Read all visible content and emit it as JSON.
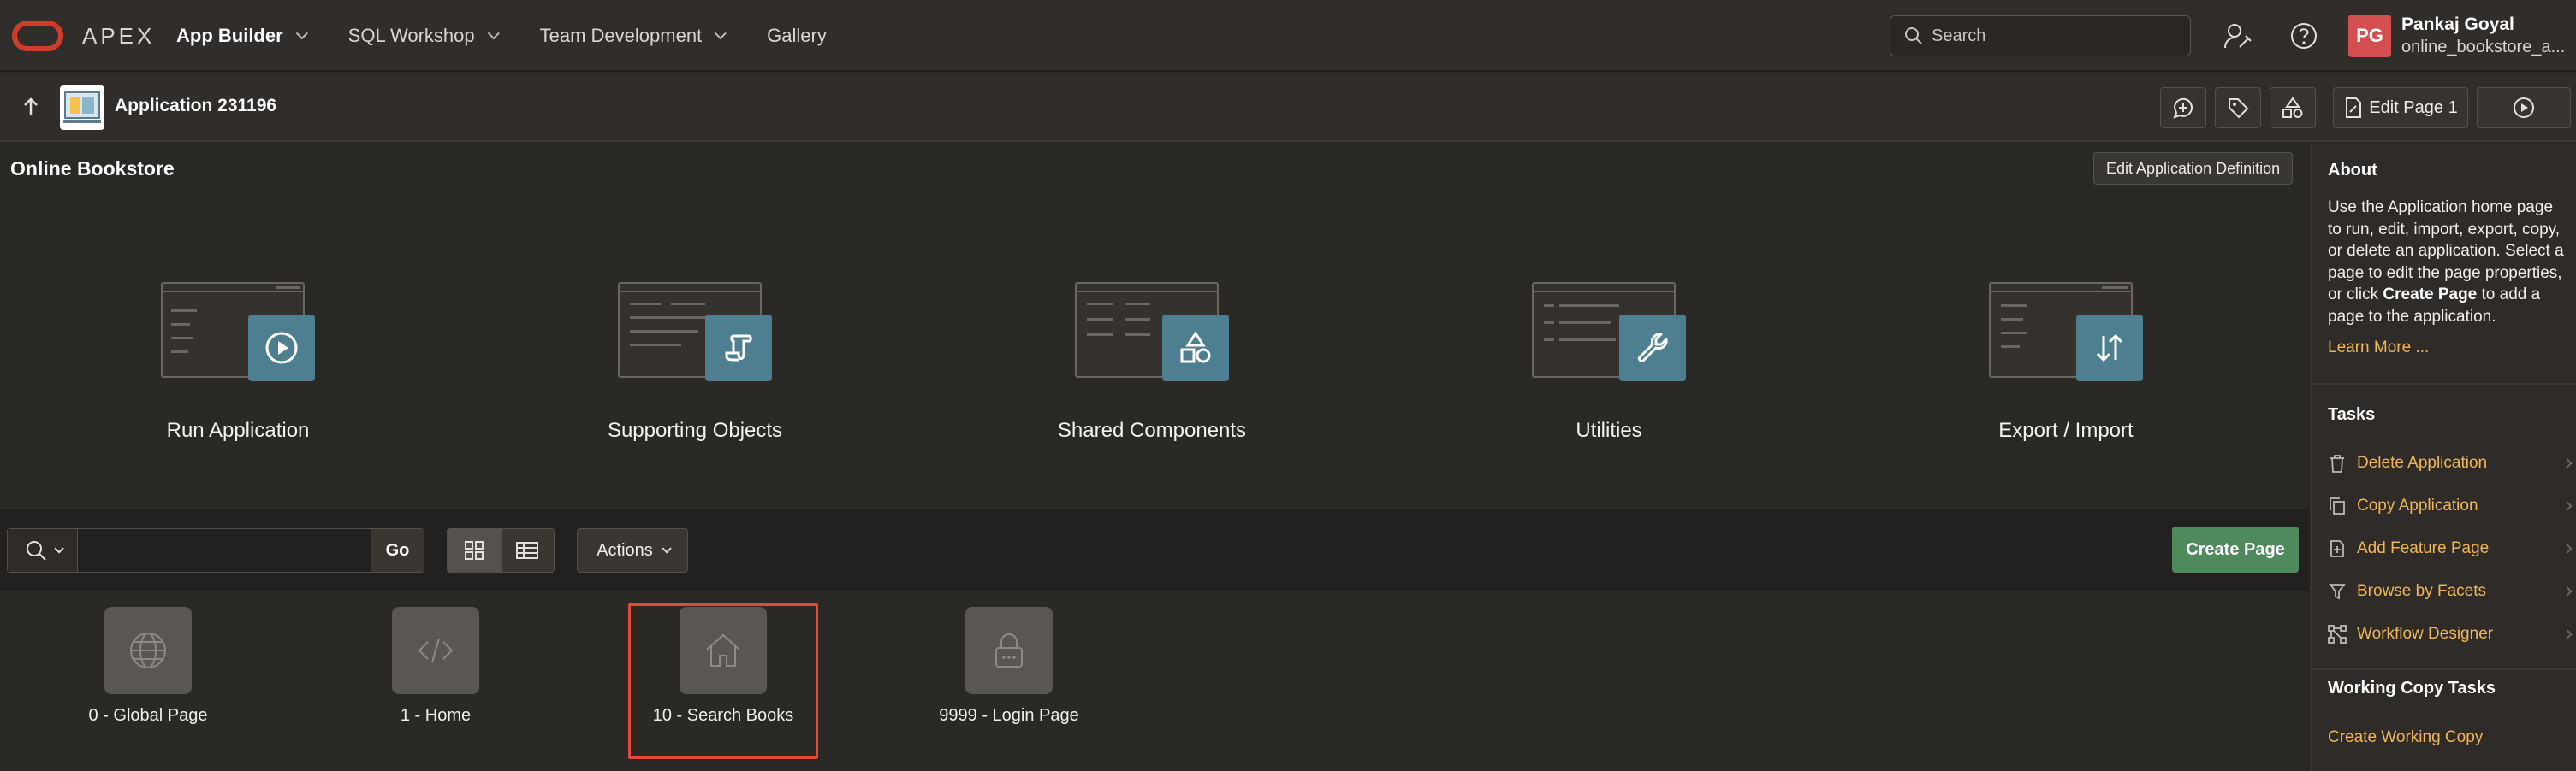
{
  "header": {
    "brand": "APEX",
    "nav": [
      {
        "label": "App Builder",
        "active": true
      },
      {
        "label": "SQL Workshop",
        "active": false
      },
      {
        "label": "Team Development",
        "active": false
      },
      {
        "label": "Gallery",
        "active": false
      }
    ],
    "search_placeholder": "Search",
    "user": {
      "initials": "PG",
      "name": "Pankaj Goyal",
      "workspace": "online_bookstore_a..."
    }
  },
  "appbar": {
    "app_title": "Application 231196",
    "edit_page_label": "Edit Page 1"
  },
  "main": {
    "section_title": "Online Bookstore",
    "edit_definition_label": "Edit Application Definition",
    "tiles": [
      {
        "label": "Run Application",
        "icon": "play-icon"
      },
      {
        "label": "Supporting Objects",
        "icon": "scroll-icon"
      },
      {
        "label": "Shared Components",
        "icon": "shapes-icon"
      },
      {
        "label": "Utilities",
        "icon": "wrench-icon"
      },
      {
        "label": "Export / Import",
        "icon": "arrows-updown-icon"
      }
    ],
    "toolbar": {
      "search_value": "",
      "go_label": "Go",
      "actions_label": "Actions",
      "create_page_label": "Create Page"
    },
    "pages": [
      {
        "label": "0 - Global Page",
        "icon": "globe-icon"
      },
      {
        "label": "1 - Home",
        "icon": "code-icon"
      },
      {
        "label": "10 - Search Books",
        "icon": "home-icon"
      },
      {
        "label": "9999 - Login Page",
        "icon": "lock-icon"
      }
    ]
  },
  "sidebar": {
    "about_title": "About",
    "about_text_1": "Use the Application home page to run, edit, import, export, copy, or delete an application. Select a page to edit the page properties, or click ",
    "about_bold": "Create Page",
    "about_text_2": " to add a page to the application.",
    "learn_more": "Learn More ...",
    "tasks_title": "Tasks",
    "tasks": [
      {
        "label": "Delete Application",
        "icon": "trash-icon"
      },
      {
        "label": "Copy Application",
        "icon": "copy-icon"
      },
      {
        "label": "Add Feature Page",
        "icon": "add-page-icon"
      },
      {
        "label": "Browse by Facets",
        "icon": "filter-icon"
      },
      {
        "label": "Workflow Designer",
        "icon": "workflow-icon"
      }
    ],
    "working_copy_title": "Working Copy Tasks",
    "create_working_copy": "Create Working Copy"
  },
  "colors": {
    "accent": "#f0b65a",
    "brand_red": "#d03b2b",
    "tile_badge": "#4d7f91",
    "create_green": "#4e8a5c"
  }
}
